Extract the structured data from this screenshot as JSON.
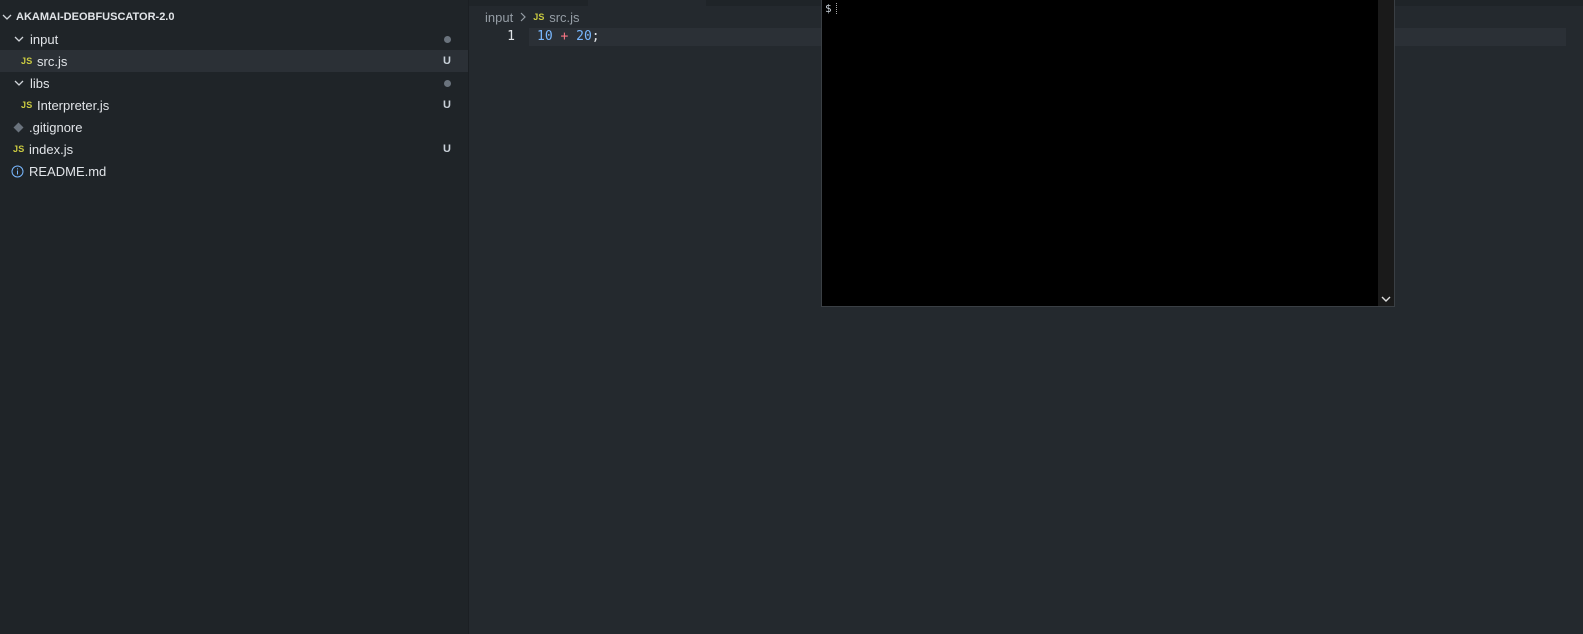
{
  "explorer": {
    "root_label": "AKAMAI-DEOBFUSCATOR-2.0",
    "items": [
      {
        "label": "input",
        "kind": "folder",
        "status": "dot"
      },
      {
        "label": "src.js",
        "kind": "js",
        "status": "U",
        "icon_text": "JS"
      },
      {
        "label": "libs",
        "kind": "folder",
        "status": "dot"
      },
      {
        "label": "Interpreter.js",
        "kind": "js",
        "status": "U",
        "icon_text": "JS"
      },
      {
        "label": ".gitignore",
        "kind": "git"
      },
      {
        "label": "index.js",
        "kind": "js",
        "status": "U",
        "icon_text": "JS"
      },
      {
        "label": "README.md",
        "kind": "info"
      }
    ]
  },
  "editor": {
    "breadcrumb": [
      "input",
      "src.js"
    ],
    "breadcrumb_icon_text": "JS",
    "line_number": "1",
    "code": {
      "a": "10",
      "op": "+",
      "b": "20",
      "end": ";"
    }
  },
  "terminal": {
    "prompt": "$"
  },
  "colors": {
    "sidebar_bg": "#1f2428",
    "editor_bg": "#24292e",
    "number": "#79b8ff",
    "operator": "#f97583",
    "js_icon": "#cbcb41"
  }
}
